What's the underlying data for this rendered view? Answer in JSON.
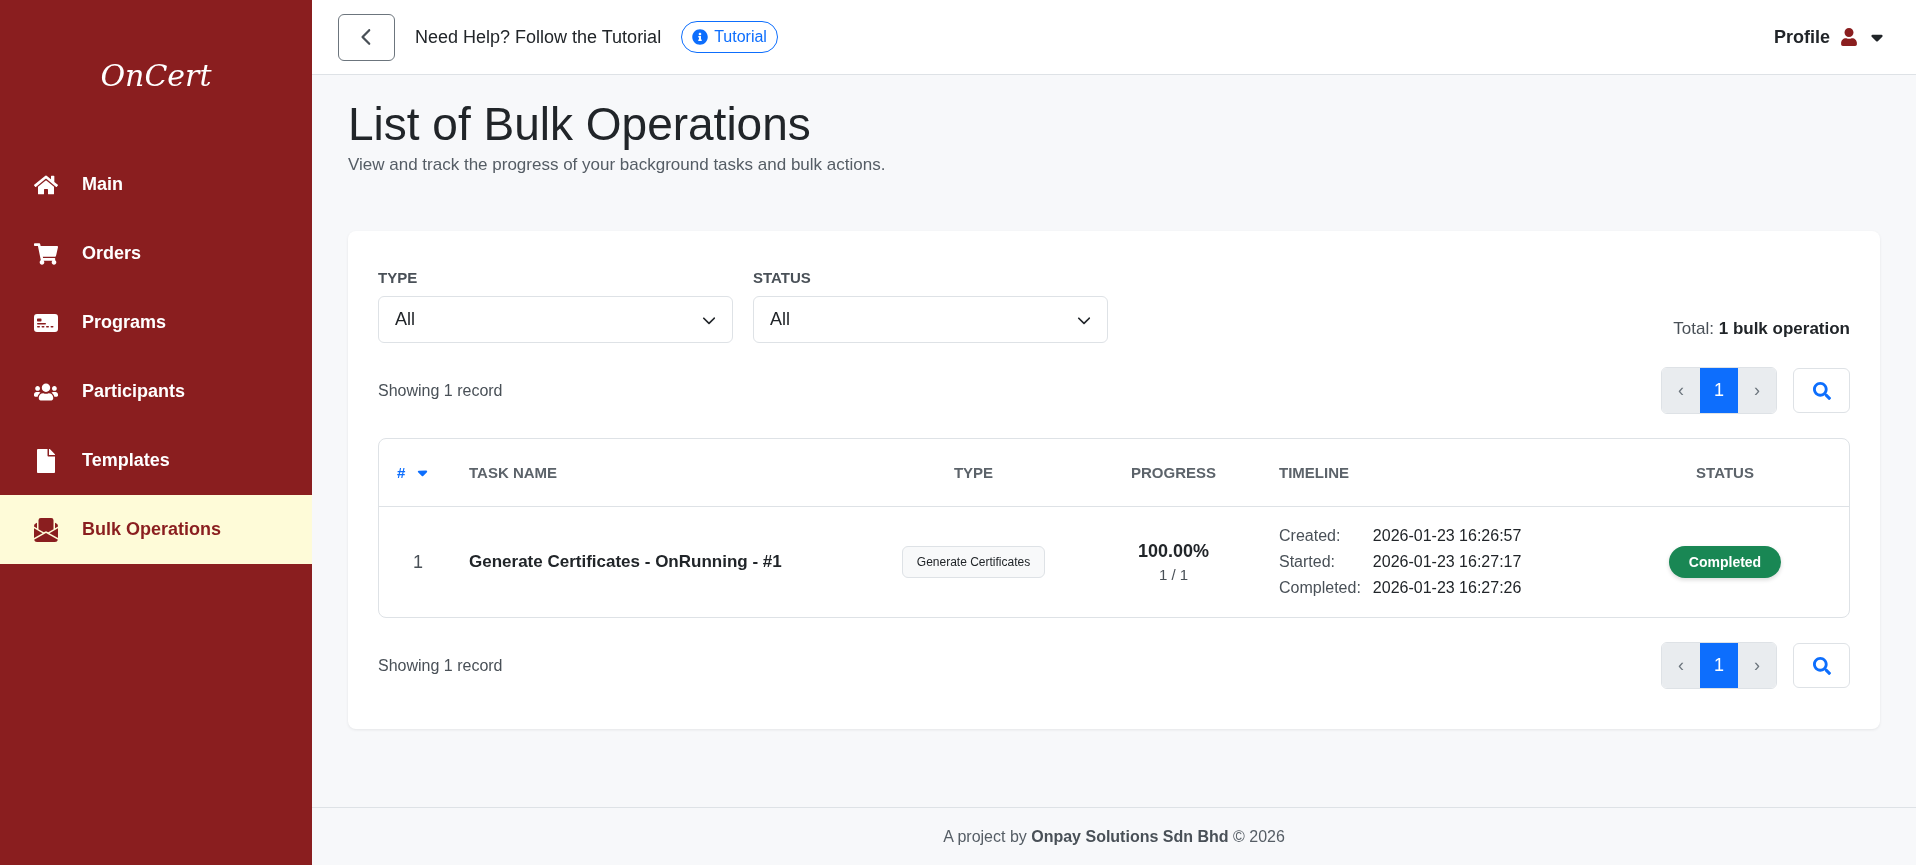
{
  "sidebar": {
    "logo": "OnCert",
    "items": [
      {
        "label": "Main",
        "selected": false
      },
      {
        "label": "Orders",
        "selected": false
      },
      {
        "label": "Programs",
        "selected": false
      },
      {
        "label": "Participants",
        "selected": false
      },
      {
        "label": "Templates",
        "selected": false
      },
      {
        "label": "Bulk Operations",
        "selected": true
      }
    ]
  },
  "header": {
    "help_text": "Need Help? Follow the Tutorial",
    "tutorial_button": "Tutorial",
    "profile": "Profile"
  },
  "page": {
    "title": "List of Bulk Operations",
    "subtitle": "View and track the progress of your background tasks and bulk actions."
  },
  "filters": [
    {
      "label": "TYPE",
      "value": "All"
    },
    {
      "label": "STATUS",
      "value": "All"
    }
  ],
  "total": "Total: **1 bulk operation**",
  "showing_top": "Showing 1 record",
  "showing_bottom": "Showing 1 record",
  "pagination_top": {
    "prev": "‹",
    "next": "›",
    "pages": [
      {
        "label": "1",
        "selected": true
      }
    ]
  },
  "pagination_bottom": {
    "prev": "‹",
    "next": "›",
    "pages": [
      {
        "label": "1",
        "selected": true
      }
    ]
  },
  "table": {
    "columns": [
      {
        "label": "#",
        "sorted": true
      },
      {
        "label": "TASK NAME",
        "sorted": false
      },
      {
        "label": "TYPE",
        "sorted": false
      },
      {
        "label": "PROGRESS",
        "sorted": false
      },
      {
        "label": "TIMELINE",
        "sorted": false
      },
      {
        "label": "STATUS",
        "sorted": false
      }
    ],
    "rows": [
      {
        "number": "1",
        "task_name": "Generate Certificates - OnRunning - #1",
        "type": "Generate Certificates",
        "progress": "100.00%",
        "progress_count": "1 / 1",
        "timeline": [
          {
            "label": "Created:",
            "value": "2026-01-23 16:26:57"
          },
          {
            "label": "Started:",
            "value": "2026-01-23 16:27:17"
          },
          {
            "label": "Completed:",
            "value": "2026-01-23 16:27:26"
          }
        ],
        "status": "Completed"
      }
    ]
  },
  "footer": "A project by **Onpay Solutions Sdn Bhd** © 2026"
}
